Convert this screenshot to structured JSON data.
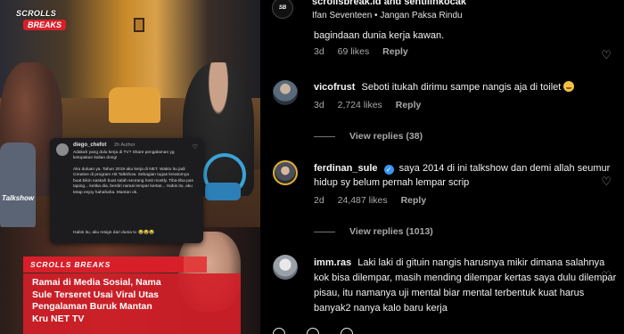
{
  "media": {
    "logo_top": "SCROLLS",
    "logo_bottom": "BREAKS",
    "talkshow_tag": "Talkshow",
    "inner_comment": {
      "username": "diego_chefot",
      "time": "2h  Author",
      "paragraph_1": "Adakah yang dulu kerja di TV? Share pengalaman yg ketupakan kalian dong!",
      "paragraph_2": "Aku duluan ya. Tahun 2019 aku kerja di NET. Waktu itu jadi Creative di program Hit Talkshow. Sebagian tugas kreatornya buat bikin naskah buat salah seorang host mostly. Tiba-tiba pas taping... ketika dia, berdiri narasi lempar kertas... Habis itu, aku tetap enjoy hahahaha. Mantan ok.",
      "paragraph_3": "Habis itu, aku resign dari dunia tv. 😂😂😂"
    },
    "brand_strip": "SCROLLS BREAKS",
    "headline_lines": [
      "Ramai di Media Sosial, Nama",
      "Sule Terseret Usai Viral Utas",
      "Pengalaman Buruk Mantan",
      "Kru NET TV"
    ]
  },
  "post_header": {
    "avatar_text": "SB",
    "title": "scrollsbreak.id and sentilinkocak",
    "music": "Ifan Seventeen • Jangan Paksa Rindu"
  },
  "comments": [
    {
      "text": "bagindaan dunia kerja kawan.",
      "time": "3d",
      "likes": "69 likes",
      "reply": "Reply"
    },
    {
      "username": "vicofrust",
      "text": "Seboti itukah dirimu sampe nangis aja di toilet",
      "time": "3d",
      "likes": "2,724 likes",
      "reply": "Reply",
      "view_replies": "View replies (38)"
    },
    {
      "username": "ferdinan_sule",
      "verified": "✓",
      "text": "saya 2014 di ini talkshow dan demi allah seumur hidup sy belum pernah lempar scrip",
      "time": "2d",
      "likes": "24,487 likes",
      "reply": "Reply",
      "view_replies": "View replies (1013)"
    },
    {
      "username": "imm.ras",
      "text": "Laki laki di gituin nangis harusnya mikir dimana salahnya kok bisa dilempar, masih mending dilempar kertas saya dulu dilempar pisau, itu namanya uji mental biar mental terbentuk kuat harus banyak2 nanya kalo baru kerja"
    }
  ],
  "icons": {
    "heart": "♡"
  },
  "colors": {
    "background": "#000000",
    "verified": "#3897f0",
    "brand_red": "#d71f2a",
    "muted_text": "#a8a8a8"
  }
}
